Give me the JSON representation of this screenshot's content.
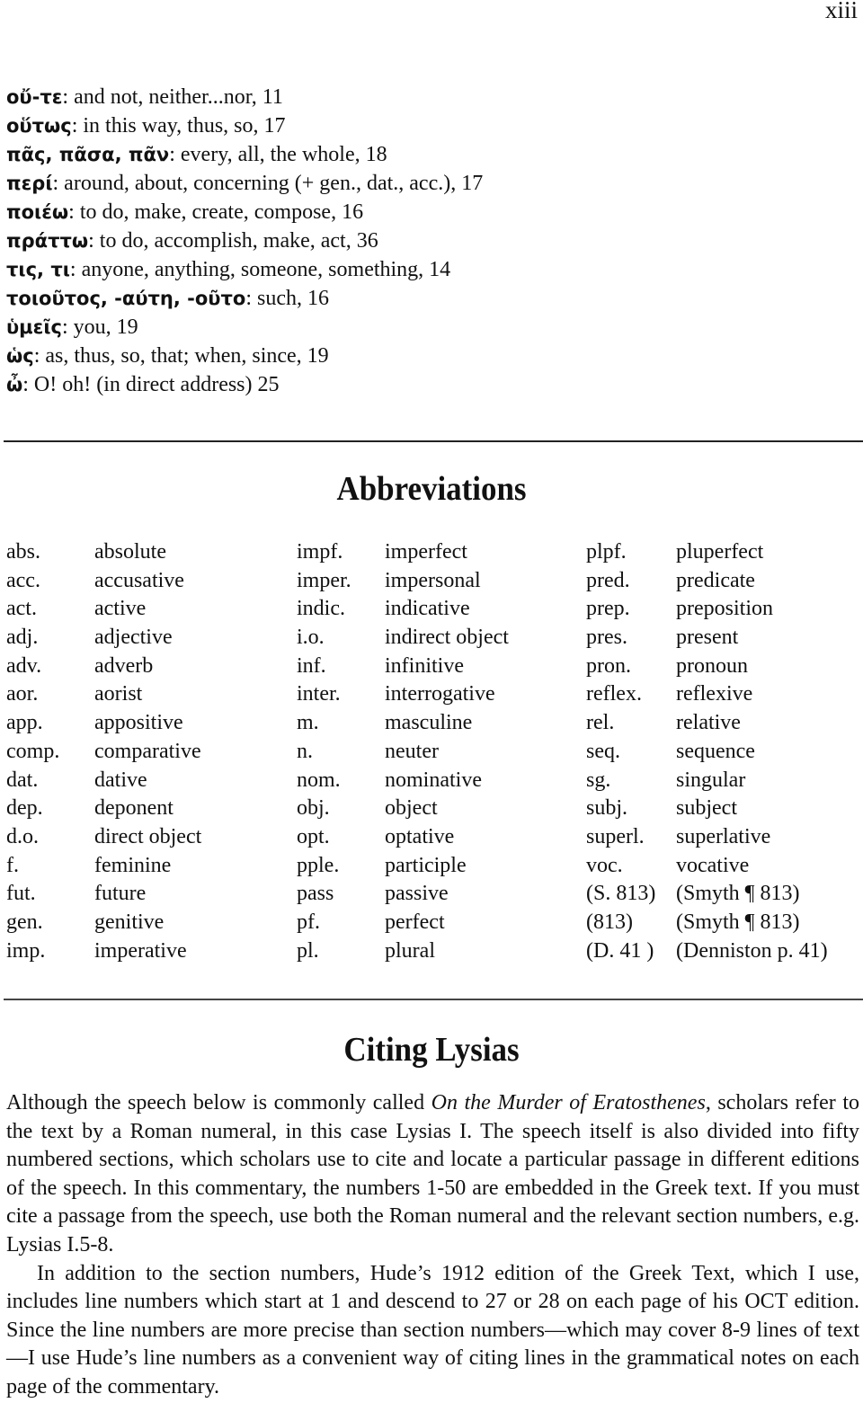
{
  "page_number": "xiii",
  "vocabulary": [
    {
      "greek": "οὔ-τε",
      "gloss": ": and not, neither...nor, 11"
    },
    {
      "greek": "οὕτως",
      "gloss": ": in this way, thus, so, 17"
    },
    {
      "greek": "πᾶς, πᾶσα, πᾶν",
      "gloss": ": every, all, the whole, 18"
    },
    {
      "greek": "περί",
      "gloss": ": around, about, concerning  (+ gen., dat., acc.), 17"
    },
    {
      "greek": "ποιέω",
      "gloss": ": to do, make, create, compose, 16"
    },
    {
      "greek": "πράττω",
      "gloss": ": to do, accomplish, make, act, 36"
    },
    {
      "greek": "τις, τι",
      "gloss": ": anyone, anything, someone, something, 14"
    },
    {
      "greek": "τοιοῦτος, -αύτη, -οῦτο",
      "gloss": ": such, 16"
    },
    {
      "greek": "ὑμεῖς",
      "gloss": ": you, 19"
    },
    {
      "greek": "ὡς",
      "gloss": ": as, thus, so, that; when, since, 19"
    },
    {
      "greek": "ὦ",
      "gloss": ": O! oh! (in direct address) 25"
    }
  ],
  "abbreviations": {
    "title": "Abbreviations",
    "rows": [
      [
        [
          "abs.",
          "absolute"
        ],
        [
          "impf.",
          "imperfect"
        ],
        [
          "plpf.",
          "pluperfect"
        ]
      ],
      [
        [
          "acc.",
          "accusative"
        ],
        [
          "imper.",
          "impersonal"
        ],
        [
          "pred.",
          "predicate"
        ]
      ],
      [
        [
          "act.",
          "active"
        ],
        [
          "indic.",
          "indicative"
        ],
        [
          "prep.",
          "preposition"
        ]
      ],
      [
        [
          "adj.",
          "adjective"
        ],
        [
          "i.o.",
          "indirect object"
        ],
        [
          "pres.",
          "present"
        ]
      ],
      [
        [
          "adv.",
          "adverb"
        ],
        [
          "inf.",
          "infinitive"
        ],
        [
          "pron.",
          "pronoun"
        ]
      ],
      [
        [
          "aor.",
          "aorist"
        ],
        [
          "inter.",
          "interrogative"
        ],
        [
          "reflex.",
          "reflexive"
        ]
      ],
      [
        [
          "app.",
          "appositive"
        ],
        [
          "m.",
          "masculine"
        ],
        [
          "rel.",
          "relative"
        ]
      ],
      [
        [
          "comp.",
          "comparative"
        ],
        [
          "n.",
          "neuter"
        ],
        [
          "seq.",
          "sequence"
        ]
      ],
      [
        [
          "dat.",
          "dative"
        ],
        [
          "nom.",
          "nominative"
        ],
        [
          "sg.",
          "singular"
        ]
      ],
      [
        [
          "dep.",
          "deponent"
        ],
        [
          "obj.",
          "object"
        ],
        [
          "subj.",
          "subject"
        ]
      ],
      [
        [
          "d.o.",
          "direct object"
        ],
        [
          "opt.",
          "optative"
        ],
        [
          "superl.",
          "superlative"
        ]
      ],
      [
        [
          "f.",
          "feminine"
        ],
        [
          "pple.",
          "participle"
        ],
        [
          "voc.",
          "vocative"
        ]
      ],
      [
        [
          "fut.",
          "future"
        ],
        [
          "pass",
          "passive"
        ],
        [
          "(S. 813)",
          "(Smyth  ¶ 813)"
        ]
      ],
      [
        [
          "gen.",
          "genitive"
        ],
        [
          "pf.",
          "perfect"
        ],
        [
          "(813)",
          "(Smyth  ¶ 813)"
        ]
      ],
      [
        [
          "imp.",
          "imperative"
        ],
        [
          "pl.",
          "plural"
        ],
        [
          "(D. 41 )",
          "(Denniston p. 41)"
        ]
      ]
    ]
  },
  "citing": {
    "title": "Citing Lysias",
    "p1_before": "Although the speech below is commonly called ",
    "p1_italic": "On the Murder of Eratosthenes",
    "p1_after": ", scholars refer to the text by a Roman numeral, in this case Lysias I. The speech itself is also divided into fifty numbered sections, which scholars use to cite and locate a particular passage in different editions of the speech. In this commentary, the numbers 1-50 are embedded in the Greek text. If you must cite a passage from the speech, use both the Roman numeral and the relevant section numbers, e.g. Lysias I.5-8.",
    "p2": "In addition to the section numbers, Hude’s 1912 edition of the Greek Text, which I use, includes line numbers which start at 1 and descend to 27 or 28 on each page of his OCT edition. Since the line numbers are more precise than section numbers—which may cover 8-9 lines of text—I use Hude’s line numbers as a convenient way of citing lines in the grammatical notes on each page of the commentary."
  }
}
